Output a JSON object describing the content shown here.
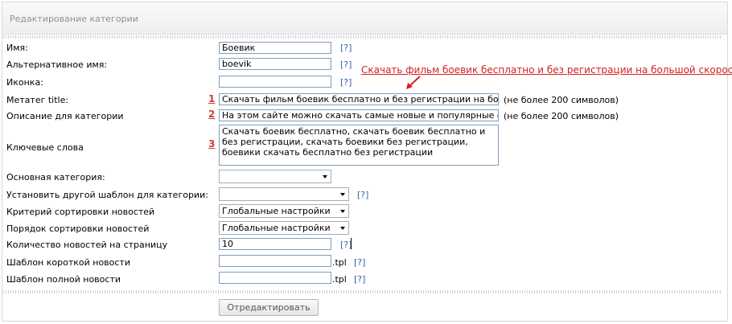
{
  "panel": {
    "title": "Редактирование категории"
  },
  "annotation": {
    "link_text": "Скачать фильм боевик бесплатно и без регистрации на большой скорости",
    "markers": [
      "1",
      "2",
      "3"
    ]
  },
  "rows": {
    "name": {
      "label": "Имя:",
      "value": "Боевик",
      "help": "[?]"
    },
    "alt_name": {
      "label": "Альтернативное имя:",
      "value": "boevik",
      "help": "[?]"
    },
    "icon": {
      "label": "Иконка:",
      "value": "",
      "help": "[?]"
    },
    "meta_title": {
      "label": "Метатег title:",
      "value": "Скачать фильм боевик бесплатно и без регистрации на большой скорости",
      "note": "(не более 200 символов)"
    },
    "description": {
      "label": "Описание для категории",
      "value": "На этом сайте можно скачать самые новые и популярные фильмы",
      "note": "(не более 200 символов)"
    },
    "keywords": {
      "label": "Ключевые слова",
      "value": "Скачать боевик бесплатно, скачать боевик бесплатно и без регистрации, скачать боевики без регистрации, боевики скачать бесплатно без регистрации"
    },
    "parent": {
      "label": "Основная категория:",
      "value": ""
    },
    "template": {
      "label": "Установить другой шаблон для категории:",
      "value": "",
      "help": "[?]"
    },
    "sort_criteria": {
      "label": "Критерий сортировки новостей",
      "value": "Глобальные настройки"
    },
    "sort_order": {
      "label": "Порядок сортировки новостей",
      "value": "Глобальные настройки"
    },
    "per_page": {
      "label": "Количество новостей на страницу",
      "value": "10",
      "help": "[?]"
    },
    "short_tpl": {
      "label": "Шаблон короткой новости",
      "value": "",
      "suffix": ".tpl",
      "help": "[?]"
    },
    "full_tpl": {
      "label": "Шаблон полной новости",
      "value": "",
      "suffix": ".tpl",
      "help": "[?]"
    }
  },
  "actions": {
    "submit_label": "Отредактировать"
  },
  "colors": {
    "annotation": "#d42020",
    "help_link": "#2d63ad",
    "input_border": "#7f9db9"
  }
}
